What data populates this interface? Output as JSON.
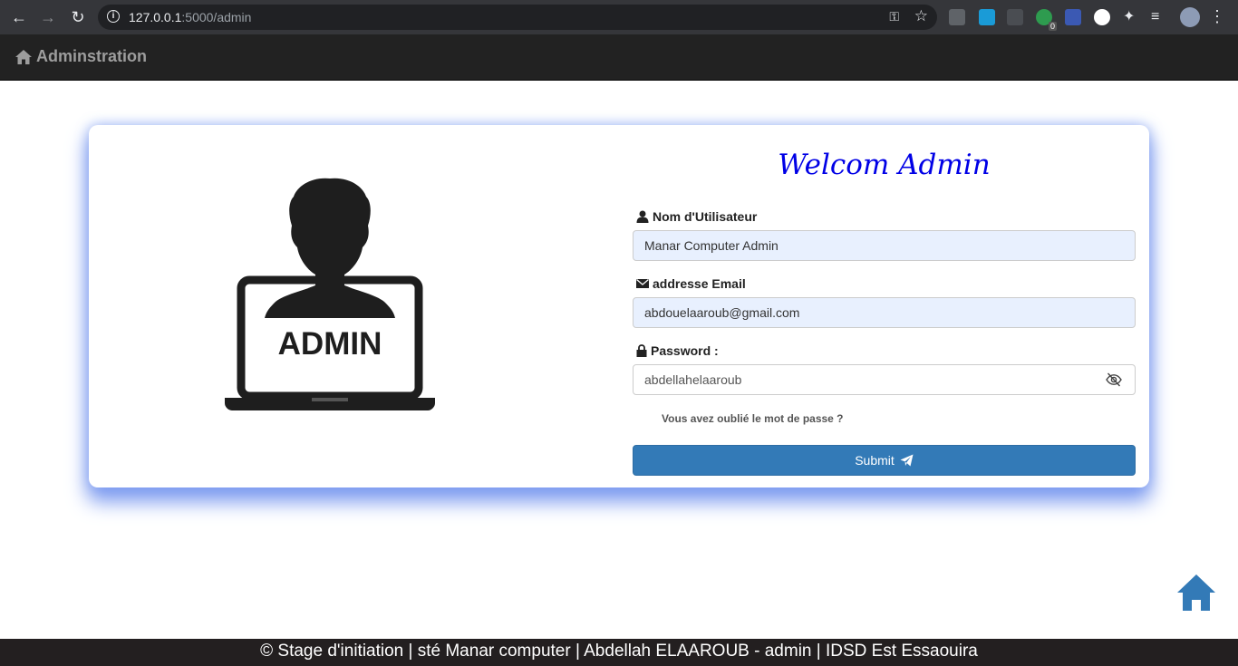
{
  "browser": {
    "url_host": "127.0.0.1",
    "url_path": ":5000/admin",
    "extension_badge": "0"
  },
  "navbar": {
    "brand": "Adminstration"
  },
  "card": {
    "image_text": "ADMIN",
    "title": "Welcom Admin",
    "username": {
      "label": "Nom d'Utilisateur",
      "value": "Manar Computer Admin"
    },
    "email": {
      "label": "addresse Email",
      "value": "abdouelaaroub@gmail.com"
    },
    "password": {
      "label": "Password :",
      "value": "abdellahelaaroub"
    },
    "forgot": "Vous avez oublié le mot de passe ?",
    "submit": "Submit"
  },
  "footer": {
    "text": "© Stage d'initiation | sté Manar computer | Abdellah ELAAROUB - admin | IDSD Est Essaouira"
  },
  "colors": {
    "accent": "#337ab7",
    "title": "#0000e6",
    "shadow": "#7e9cf0",
    "navbar": "#222222"
  }
}
